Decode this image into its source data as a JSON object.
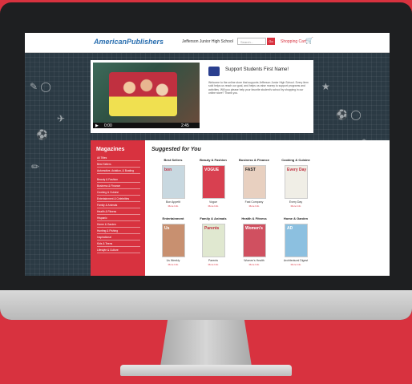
{
  "header": {
    "logo": "AmericanPublishers",
    "school": "Jefferson Junior High School",
    "search_placeholder": "Search...",
    "go_label": "Go",
    "cart_label": "Shopping Cart",
    "cart_icon": "shopping-cart-icon"
  },
  "hero": {
    "title": "Support Students First Name!",
    "text": "Welcome to the online store that supports Jefferson Junior High School. Every item sold helps us reach our goal, and helps us raise money to support programs and activities. Will you please help your favorite student's school by shopping in our online store? Thank you.",
    "video_time": "0:00",
    "video_duration": "2:45"
  },
  "sidebar": {
    "title": "Magazines",
    "items": [
      {
        "label": "All Titles"
      },
      {
        "label": "Best Sellers"
      },
      {
        "label": "Automotive, Aviation, & Boating"
      },
      {
        "label": "Beauty & Fashion"
      },
      {
        "label": "Business & Finance"
      },
      {
        "label": "Cooking & Cuisine"
      },
      {
        "label": "Entertainment & Celebrities"
      },
      {
        "label": "Family & Animals"
      },
      {
        "label": "Health & Fitness"
      },
      {
        "label": "Hispanic"
      },
      {
        "label": "Home & Garden"
      },
      {
        "label": "Hunting & Fishing"
      },
      {
        "label": "Inspirational"
      },
      {
        "label": "Kids & Teens"
      },
      {
        "label": "Lifestyle & Culture"
      }
    ]
  },
  "suggested": {
    "title": "Suggested for You",
    "more_label": "More Info",
    "rows": [
      [
        {
          "category": "Best Sellers",
          "name": "Bon Appetit",
          "cover": "#c8d8e0",
          "masthead": "bon",
          "color": "#c03040"
        },
        {
          "category": "Beauty & Fashion",
          "name": "Vogue",
          "cover": "#d84050",
          "masthead": "VOGUE",
          "color": "#ffffff"
        },
        {
          "category": "Business & Finance",
          "name": "Fast Company",
          "cover": "#e8d0c0",
          "masthead": "FAST",
          "color": "#222222"
        },
        {
          "category": "Cooking & Cuisine",
          "name": "Every Day",
          "cover": "#f0eee6",
          "masthead": "Every Day",
          "color": "#c03040"
        }
      ],
      [
        {
          "category": "Entertainment",
          "name": "Us Weekly",
          "cover": "#c89070",
          "masthead": "Us",
          "color": "#ffffff"
        },
        {
          "category": "Family & Animals",
          "name": "Parents",
          "cover": "#e0e8d0",
          "masthead": "Parents",
          "color": "#c03040"
        },
        {
          "category": "Health & Fitness",
          "name": "Women's Health",
          "cover": "#d05060",
          "masthead": "Women's",
          "color": "#ffffff"
        },
        {
          "category": "Home & Garden",
          "name": "Architectural Digest",
          "cover": "#8cc0e0",
          "masthead": "AD",
          "color": "#ffffff"
        }
      ]
    ]
  }
}
